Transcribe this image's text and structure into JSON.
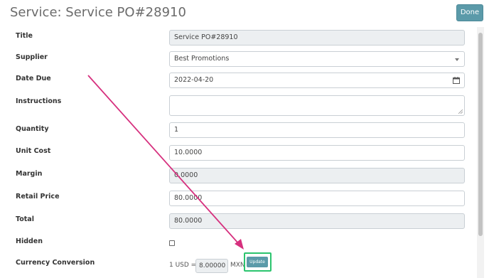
{
  "header": {
    "title": "Service: Service PO#28910",
    "done_label": "Done"
  },
  "form": {
    "title": {
      "label": "Title",
      "value": "Service PO#28910"
    },
    "supplier": {
      "label": "Supplier",
      "value": "Best Promotions"
    },
    "date_due": {
      "label": "Date Due",
      "value": "2022-04-20"
    },
    "instructions": {
      "label": "Instructions",
      "value": ""
    },
    "quantity": {
      "label": "Quantity",
      "value": "1"
    },
    "unit_cost": {
      "label": "Unit Cost",
      "value": "10.0000"
    },
    "margin": {
      "label": "Margin",
      "value": "0.0000"
    },
    "retail_price": {
      "label": "Retail Price",
      "value": "80.0000"
    },
    "total": {
      "label": "Total",
      "value": "80.0000"
    },
    "hidden": {
      "label": "Hidden",
      "checked": false
    },
    "currency_conversion": {
      "label": "Currency Conversion",
      "prefix": "1 USD =",
      "rate": "8.00000",
      "suffix": "MXN",
      "update_label": "Update"
    }
  },
  "colors": {
    "accent": "#5b9aa9",
    "highlight": "#2bc46e",
    "annotation_arrow": "#d6307e",
    "readonly_bg": "#eceff1"
  },
  "icons": [
    "calendar-icon",
    "chevron-down-icon",
    "resize-handle-icon"
  ]
}
